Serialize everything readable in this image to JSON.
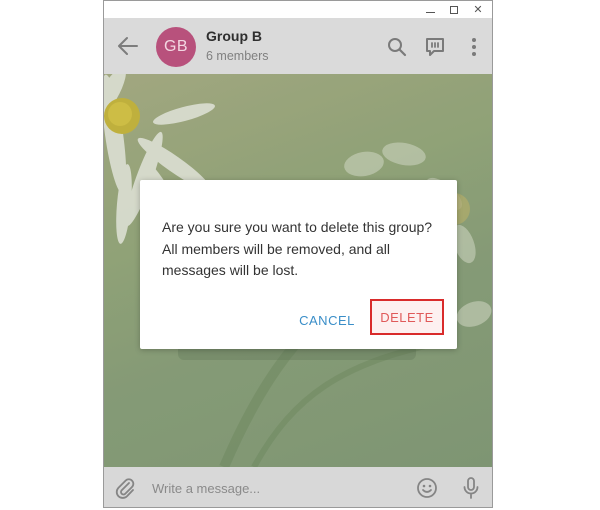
{
  "window_controls": {
    "minimize_icon": "minimize-icon",
    "maximize_icon": "maximize-icon",
    "close_glyph": "✕"
  },
  "header": {
    "avatar_initials": "GB",
    "avatar_color": "#b8517c",
    "title": "Group B",
    "subtitle": "6 members",
    "icons": [
      "back-arrow-icon",
      "search-icon",
      "discussion-icon",
      "more-vert-icon"
    ]
  },
  "dialog": {
    "message": "Are you sure you want to delete this group? All members will be removed, and all messages will be lost.",
    "cancel_label": "CANCEL",
    "delete_label": "DELETE",
    "cancel_color": "#3a8ec8",
    "delete_color": "#e05a5a",
    "highlight_color": "#d92b2b"
  },
  "composer": {
    "placeholder": "Write a message...",
    "value": "",
    "icons": [
      "paperclip-icon",
      "emoji-icon",
      "microphone-icon"
    ]
  }
}
